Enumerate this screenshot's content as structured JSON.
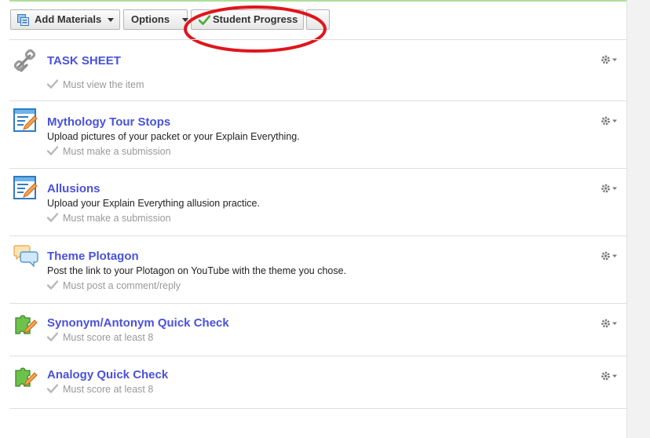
{
  "toolbar": {
    "add_materials_label": "Add Materials",
    "options_label": "Options",
    "student_progress_label": "Student Progress",
    "extra_label": ""
  },
  "colors": {
    "title_link": "#4a52d8",
    "highlight_circle": "#e0151c",
    "check_green": "#4caa3c",
    "requirement_gray": "#999999"
  },
  "items": [
    {
      "title": "TASK SHEET",
      "description": "",
      "requirement": "Must view the item",
      "icon": "link-icon"
    },
    {
      "title": "Mythology Tour Stops",
      "description": "Upload pictures of your packet or your Explain Everything.",
      "requirement": "Must make a submission",
      "icon": "assignment-icon"
    },
    {
      "title": "Allusions",
      "description": "Upload your Explain Everything allusion practice.",
      "requirement": "Must make a submission",
      "icon": "assignment-icon"
    },
    {
      "title": "Theme Plotagon",
      "description": "Post the link to your Plotagon on YouTube with the theme you chose.",
      "requirement": "Must post a comment/reply",
      "icon": "discussion-icon"
    },
    {
      "title": "Synonym/Antonym Quick Check",
      "description": "",
      "requirement": "Must score at least 8",
      "icon": "assessment-puzzle-icon"
    },
    {
      "title": "Analogy Quick Check",
      "description": "",
      "requirement": "Must score at least 8",
      "icon": "assessment-puzzle-icon"
    }
  ]
}
